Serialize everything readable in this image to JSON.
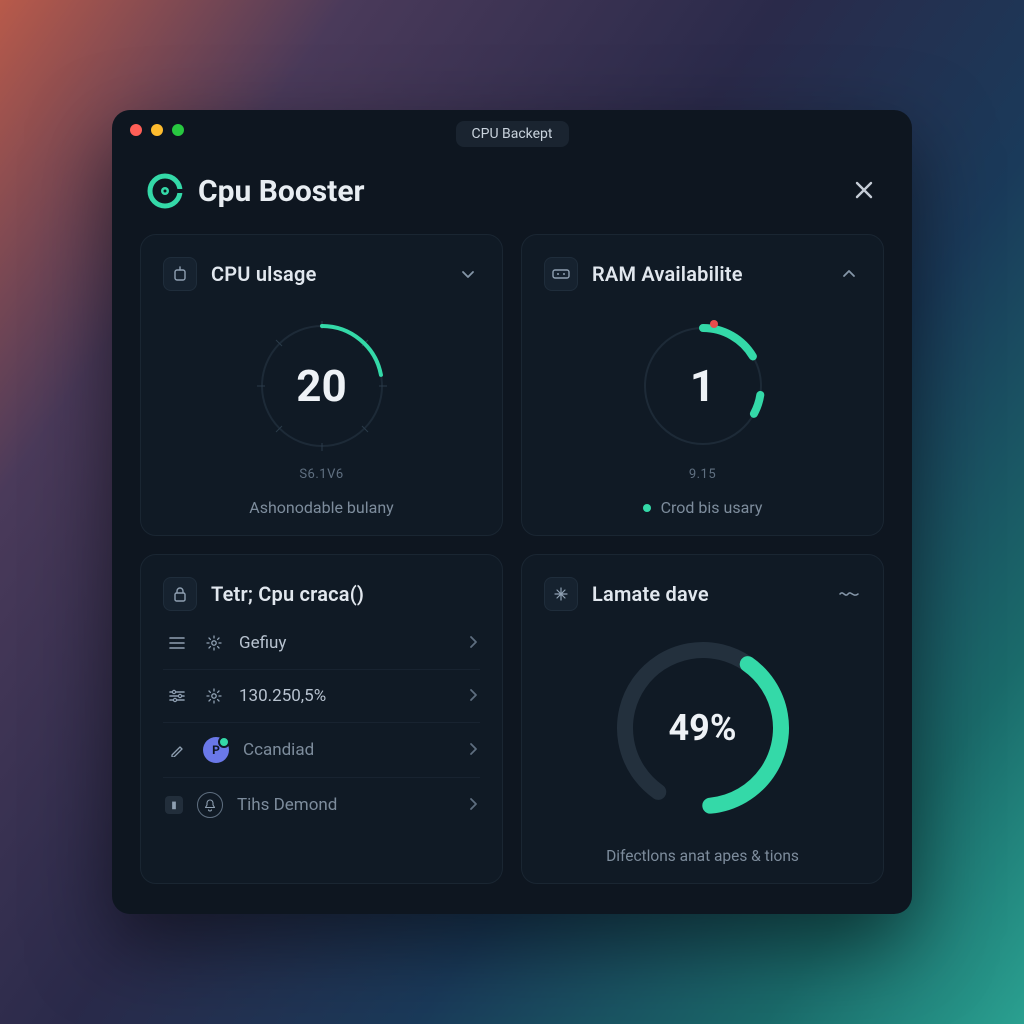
{
  "window": {
    "title": "CPU Backept"
  },
  "header": {
    "app_name": "Cpu Booster"
  },
  "cards": {
    "cpu": {
      "title": "CPU ulsage",
      "value": "20",
      "sub": "S6.1V6",
      "caption": "Ashonodable bulany",
      "gauge_pct": 22
    },
    "ram": {
      "title": "RAM Availabilite",
      "value": "1",
      "sub": "9.15",
      "caption": "Crod bis usary",
      "gauge_pct": 35
    },
    "proc": {
      "title": "Tetr; Cpu craca()",
      "items": [
        {
          "label": "Gefiuy"
        },
        {
          "label": "130.250,5%"
        },
        {
          "label": "Ccandiad"
        },
        {
          "label": "Tihs Demond"
        }
      ],
      "p_letter": "P"
    },
    "save": {
      "title": "Lamate dave",
      "value": "49%",
      "desc": "Difectlons anat apes & tions",
      "gauge_pct": 49
    }
  },
  "colors": {
    "accent": "#34d9a8"
  },
  "chart_data": [
    {
      "type": "pie",
      "title": "CPU ulsage",
      "values": [
        22,
        78
      ],
      "data_label": "20",
      "subtitle": "S6.1V6"
    },
    {
      "type": "pie",
      "title": "RAM Availabilite",
      "values": [
        35,
        65
      ],
      "data_label": "1",
      "subtitle": "9.15"
    },
    {
      "type": "pie",
      "title": "Lamate dave",
      "values": [
        49,
        51
      ],
      "data_label": "49%"
    }
  ]
}
